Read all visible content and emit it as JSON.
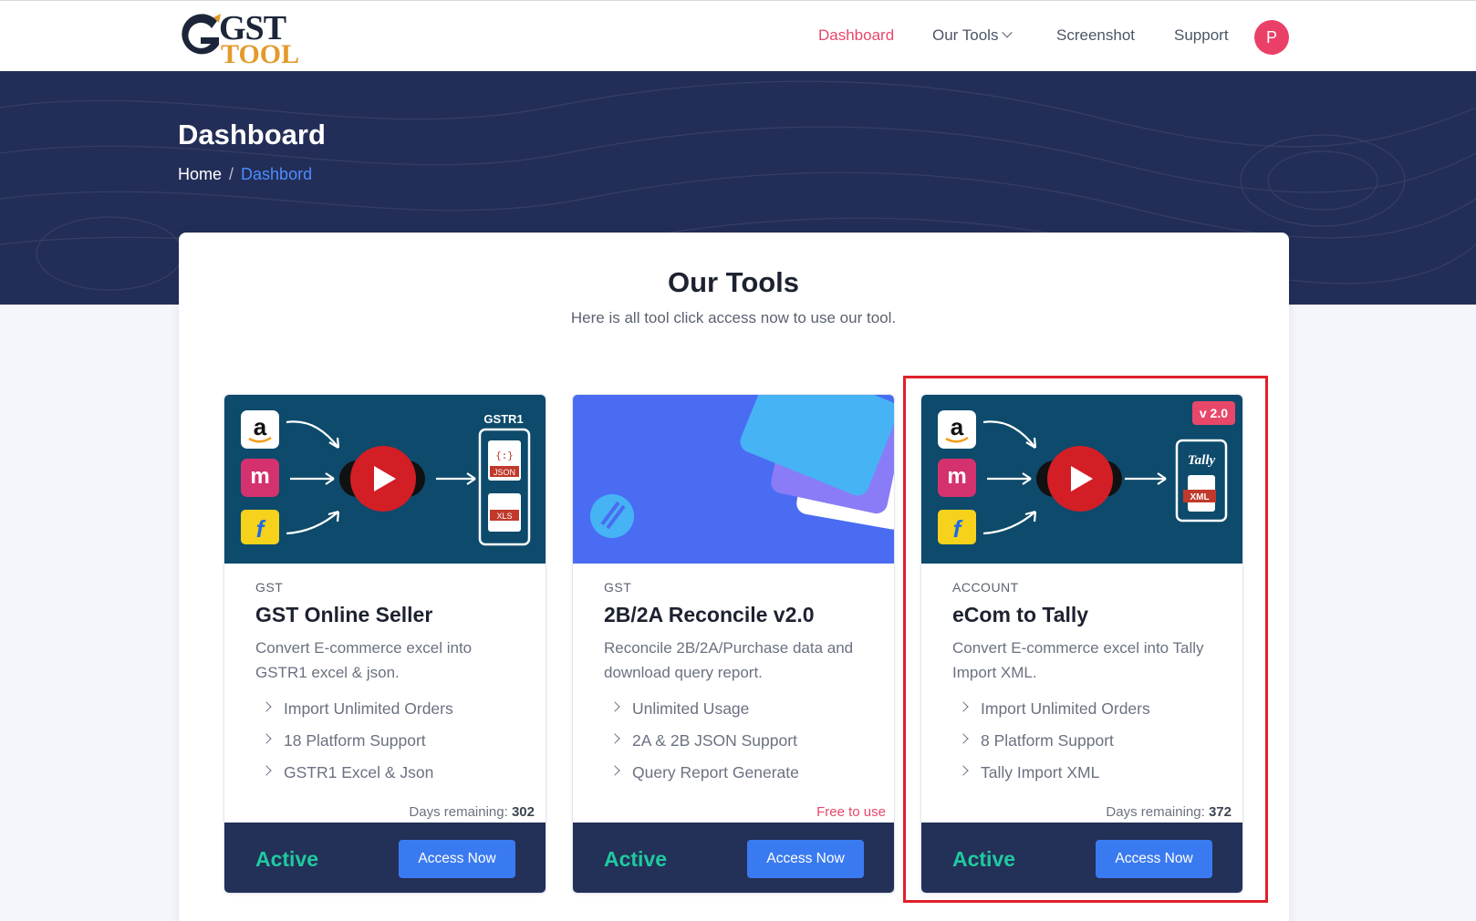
{
  "header": {
    "logo_main": "GST",
    "logo_sub": "TOOL",
    "nav": [
      {
        "label": "Dashboard",
        "active": true
      },
      {
        "label": "Our Tools",
        "active": false
      },
      {
        "label": "Screenshot",
        "active": false
      },
      {
        "label": "Support",
        "active": false
      }
    ],
    "avatar_initial": "P"
  },
  "hero": {
    "title": "Dashboard",
    "breadcrumb": {
      "home": "Home",
      "separator": "/",
      "current": "Dashbord"
    }
  },
  "tools_section": {
    "title": "Our Tools",
    "subtitle": "Here is all tool click access now to use our tool."
  },
  "cards": [
    {
      "category": "GST",
      "title": "GST Online Seller",
      "description": "Convert E-commerce excel into GSTR1 excel & json.",
      "features": [
        "Import Unlimited Orders",
        "18 Platform Support",
        "GSTR1 Excel & Json"
      ],
      "days_label": "Days remaining:",
      "days_value": "302",
      "status": "Active",
      "button": "Access Now",
      "image_label": "GSTR1",
      "image_badges": [
        "JSON",
        "XLS"
      ]
    },
    {
      "category": "GST",
      "title": "2B/2A Reconcile v2.0",
      "description": "Reconcile 2B/2A/Purchase data and download query report.",
      "features": [
        "Unlimited Usage",
        "2A & 2B JSON Support",
        "Query Report Generate"
      ],
      "free_label": "Free to use",
      "status": "Active",
      "button": "Access Now"
    },
    {
      "category": "ACCOUNT",
      "title": "eCom to Tally",
      "description": "Convert E-commerce excel into Tally Import XML.",
      "features": [
        "Import Unlimited Orders",
        "8 Platform Support",
        "Tally Import XML"
      ],
      "days_label": "Days remaining:",
      "days_value": "372",
      "status": "Active",
      "button": "Access Now",
      "version": "v 2.0",
      "image_badges": [
        "Tally",
        "XML"
      ]
    }
  ],
  "colors": {
    "hero_bg": "#232e58",
    "accent_pink": "#e8476a",
    "status_green": "#1fc9a0",
    "button_blue": "#3a7af0",
    "highlight_red": "#e0202a"
  }
}
